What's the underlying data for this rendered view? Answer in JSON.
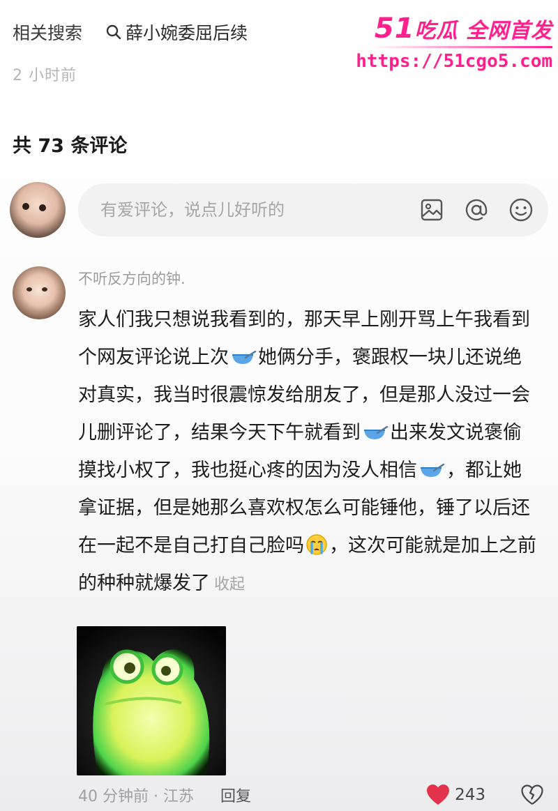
{
  "header": {
    "related_label": "相关搜索",
    "related_search": "薛小婉委屈后续",
    "time_ago": "2 小时前"
  },
  "watermark": {
    "brand_num": "51",
    "brand_text": "吃瓜 全网首发",
    "url": "https://51cgo5.com"
  },
  "comments_count": "共 73 条评论",
  "compose": {
    "placeholder": "有爱评论，说点儿好听的",
    "icons": [
      "image-icon",
      "at-icon",
      "emoji-icon"
    ]
  },
  "comment": {
    "username": "不听反方向的钟.",
    "segments": [
      "家人们我只想说我看到的，那天早上刚开骂上午我看到个网友评论说上次",
      "她俩分手，褒跟权一块儿还说绝对真实，我当时很震惊发给朋友了，但是那人没过一会儿删评论了，结果今天下午就看到",
      "出来发文说褒偷摸找小权了，我也挺心疼的因为没人相信",
      "，都让她拿证据，但是她那么喜欢权怎么可能锤他，锤了以后还在一起不是自己打自己脸吗",
      "，这次可能就是加上之前的种种就爆发了"
    ],
    "collapse": "收起",
    "meta": "40 分钟前 · 江苏",
    "reply": "回复",
    "likes": "243"
  },
  "colors": {
    "accent": "#ff1f8e",
    "like_red": "#e2334b"
  }
}
